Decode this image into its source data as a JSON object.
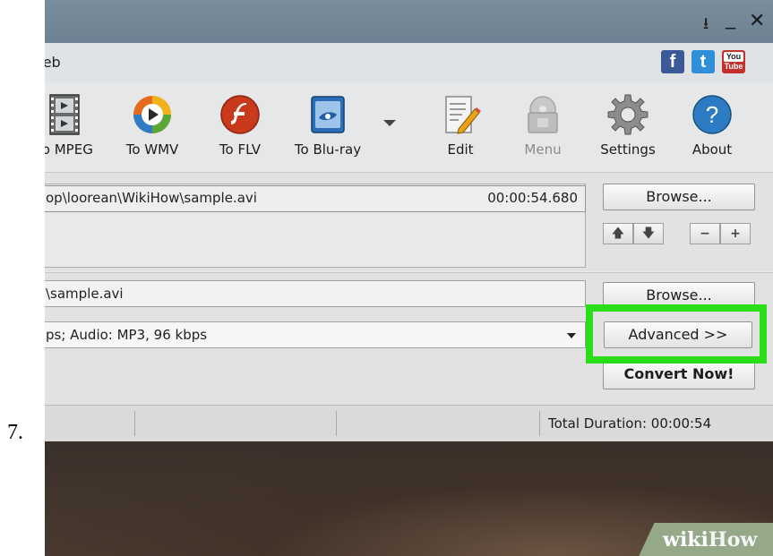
{
  "step_number": "7.",
  "window": {
    "controls": {
      "pin": "⭳",
      "minimize": "_",
      "close": "✕"
    },
    "menu": {
      "partial_item": "Veb"
    },
    "social": {
      "facebook": "f",
      "twitter": "t",
      "youtube_top": "You",
      "youtube_bottom": "Tube"
    },
    "toolbar": [
      {
        "label": "To MPEG",
        "icon": "film-strip-icon"
      },
      {
        "label": "To WMV",
        "icon": "wmv-icon"
      },
      {
        "label": "To FLV",
        "icon": "flash-icon"
      },
      {
        "label": "To Blu-ray",
        "icon": "bluray-icon"
      },
      {
        "label": "Edit",
        "icon": "edit-icon"
      },
      {
        "label": "Menu",
        "icon": "menu-disc-icon",
        "disabled": true
      },
      {
        "label": "Settings",
        "icon": "gear-icon"
      },
      {
        "label": "About",
        "icon": "help-icon"
      }
    ],
    "input": {
      "file_path": "op\\loorean\\WikiHow\\sample.avi",
      "duration": "00:00:54.680",
      "browse_label": "Browse..."
    },
    "output": {
      "file_path": "\\sample.avi",
      "browse_label": "Browse...",
      "profile": "ps; Audio: MP3, 96 kbps",
      "advanced_label": "Advanced >>",
      "convert_label": "Convert Now!"
    },
    "status": {
      "total_duration": "Total Duration: 00:00:54"
    }
  },
  "watermark": {
    "wiki": "wiki",
    "how": "How"
  },
  "colors": {
    "highlight": "#2bdc1a",
    "titlebar": "#7b8e9d"
  }
}
